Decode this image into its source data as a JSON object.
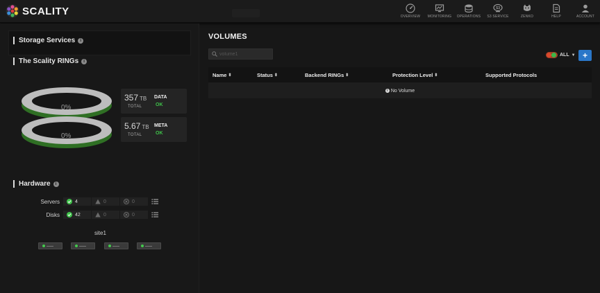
{
  "app": {
    "brand": "SCALITY"
  },
  "nav": [
    {
      "label": "OVERVIEW",
      "icon": "dashboard-icon"
    },
    {
      "label": "MONITORING",
      "icon": "monitor-icon"
    },
    {
      "label": "OPERATIONS",
      "icon": "operations-icon"
    },
    {
      "label": "S3 SERVICE",
      "icon": "s3-service-icon"
    },
    {
      "label": "ZENKO",
      "icon": "zenko-icon"
    },
    {
      "label": "HELP",
      "icon": "help-icon"
    },
    {
      "label": "ACCOUNT",
      "icon": "user-icon"
    }
  ],
  "left": {
    "storage_title": "Storage Services",
    "rings_title": "The Scality RINGs",
    "rings": [
      {
        "percent": "0%",
        "value": "357",
        "unit": "TB",
        "total": "TOTAL",
        "kind": "DATA",
        "status": "OK"
      },
      {
        "percent": "0%",
        "value": "5.67",
        "unit": "TB",
        "total": "TOTAL",
        "kind": "META",
        "status": "OK"
      }
    ],
    "hardware_title": "Hardware",
    "hardware": {
      "servers": {
        "label": "Servers",
        "ok": "4",
        "warn": "0",
        "err": "0"
      },
      "disks": {
        "label": "Disks",
        "ok": "42",
        "warn": "0",
        "err": "0"
      }
    },
    "site": "site1"
  },
  "main": {
    "title": "VOLUMES",
    "search_placeholder": "volume1",
    "filter_label": "ALL",
    "add_label": "+",
    "columns": [
      "Name",
      "Status",
      "Backend RINGs",
      "Protection Level",
      "Supported Protocols"
    ],
    "empty_text": "No Volume"
  },
  "colors": {
    "accent": "#2a77c9",
    "ok": "#3fc24a",
    "ring_top": "#c8c8c8",
    "ring_base": "#3c8f2f"
  }
}
